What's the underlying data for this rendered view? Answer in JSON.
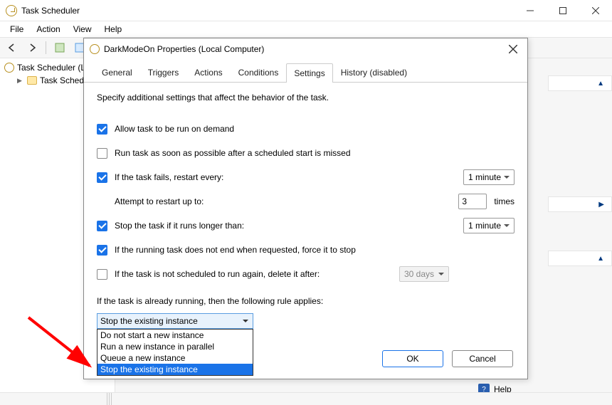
{
  "app": {
    "title": "Task Scheduler"
  },
  "menu": {
    "file": "File",
    "action": "Action",
    "view": "View",
    "help": "Help"
  },
  "tree": {
    "root": "Task Scheduler (L",
    "lib": "Task Schedul"
  },
  "help_label": "Help",
  "dialog": {
    "title": "DarkModeOn Properties (Local Computer)",
    "tabs": {
      "general": "General",
      "triggers": "Triggers",
      "actions": "Actions",
      "conditions": "Conditions",
      "settings": "Settings",
      "history": "History (disabled)"
    },
    "desc": "Specify additional settings that affect the behavior of the task.",
    "allow_on_demand": "Allow task to be run on demand",
    "run_asap": "Run task as soon as possible after a scheduled start is missed",
    "if_fails": "If the task fails, restart every:",
    "restart_interval": "1 minute",
    "attempt_label": "Attempt to restart up to:",
    "attempt_value": "3",
    "times": "times",
    "stop_longer": "Stop the task if it runs longer than:",
    "stop_longer_val": "1 minute",
    "force_stop": "If the running task does not end when requested, force it to stop",
    "delete_after": "If the task is not scheduled to run again, delete it after:",
    "delete_after_val": "30 days",
    "rule_label": "If the task is already running, then the following rule applies:",
    "combo_value": "Stop the existing instance",
    "options": {
      "o1": "Do not start a new instance",
      "o2": "Run a new instance in parallel",
      "o3": "Queue a new instance",
      "o4": "Stop the existing instance"
    },
    "ok": "OK",
    "cancel": "Cancel"
  }
}
